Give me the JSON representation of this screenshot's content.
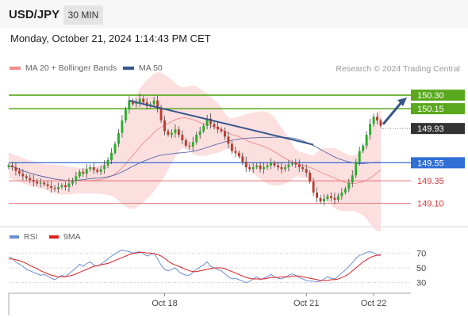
{
  "header": {
    "symbol": "USD/JPY",
    "timeframe": "30 MIN"
  },
  "datetime": "Monday, October 21, 2024 1:14:43 PM CET",
  "legend": {
    "ma20_label": "MA 20 + Bollinger Bands",
    "ma50_label": "MA 50",
    "rsi_label": "RSI",
    "rsi_ma_label": "9MA"
  },
  "credit": "Research © 2024 Trading Central",
  "colors": {
    "candle_up": "#27ae27",
    "candle_down": "#c0392b",
    "bollinger_fill": "#fcd9d9",
    "ma20": "#f08c8c",
    "ma50": "#5a6aa8",
    "trendline": "#34568b",
    "resistance": "#5aa81e",
    "pivot": "#2f6fd6",
    "support": "#e57373",
    "current_price": "#333333",
    "rsi": "#6b8fd6",
    "rsi_ma": "#e02020"
  },
  "chart_data": [
    {
      "type": "candlestick",
      "title": "USD/JPY",
      "timeframe": "30 MIN",
      "x_tick_labels": [
        "Oct 18",
        "Oct 21",
        "Oct 22"
      ],
      "ylim": [
        148.85,
        150.45
      ],
      "close_series": [
        149.52,
        149.5,
        149.46,
        149.43,
        149.4,
        149.38,
        149.36,
        149.34,
        149.32,
        149.33,
        149.31,
        149.29,
        149.27,
        149.26,
        149.28,
        149.3,
        149.28,
        149.32,
        149.35,
        149.4,
        149.45,
        149.43,
        149.48,
        149.5,
        149.47,
        149.45,
        149.48,
        149.52,
        149.58,
        149.66,
        149.76,
        149.88,
        150.02,
        150.14,
        150.24,
        150.2,
        150.22,
        150.26,
        150.22,
        150.18,
        150.2,
        150.24,
        150.16,
        150.02,
        149.9,
        149.86,
        149.88,
        149.92,
        149.86,
        149.8,
        149.74,
        149.73,
        149.78,
        149.86,
        149.9,
        149.96,
        150.04,
        149.98,
        149.95,
        149.92,
        149.9,
        149.84,
        149.76,
        149.68,
        149.66,
        149.62,
        149.56,
        149.5,
        149.48,
        149.5,
        149.52,
        149.48,
        149.5,
        149.52,
        149.55,
        149.52,
        149.5,
        149.48,
        149.5,
        149.53,
        149.55,
        149.53,
        149.5,
        149.48,
        149.44,
        149.34,
        149.22,
        149.16,
        149.12,
        149.15,
        149.18,
        149.16,
        149.14,
        149.18,
        149.22,
        149.26,
        149.33,
        149.41,
        149.56,
        149.68,
        149.74,
        149.86,
        149.98,
        150.06,
        150.02,
        149.96
      ],
      "series": [
        {
          "name": "MA 20 + Bollinger Bands"
        },
        {
          "name": "MA 50"
        }
      ],
      "levels": [
        {
          "label": "150.30",
          "value": 150.3,
          "kind": "resistance"
        },
        {
          "label": "150.15",
          "value": 150.15,
          "kind": "resistance"
        },
        {
          "label": "149.93",
          "value": 149.93,
          "kind": "current"
        },
        {
          "label": "149.55",
          "value": 149.55,
          "kind": "pivot"
        },
        {
          "label": "149.35",
          "value": 149.35,
          "kind": "support"
        },
        {
          "label": "149.10",
          "value": 149.1,
          "kind": "support"
        }
      ],
      "trendline": {
        "from_index": 34,
        "from_value": 150.24,
        "to_index": 86,
        "to_value": 149.75
      },
      "arrow": {
        "direction": "up",
        "target_value": 150.3
      }
    },
    {
      "type": "line",
      "title": "RSI",
      "series": [
        {
          "name": "RSI",
          "values": [
            65,
            63,
            58,
            55,
            52,
            48,
            46,
            44,
            42,
            40,
            41,
            39,
            36,
            34,
            37,
            40,
            38,
            42,
            46,
            50,
            55,
            52,
            56,
            58,
            54,
            52,
            55,
            58,
            62,
            66,
            69,
            72,
            74,
            73,
            72,
            70,
            71,
            72,
            69,
            66,
            68,
            70,
            62,
            54,
            48,
            46,
            48,
            50,
            45,
            42,
            40,
            40,
            44,
            48,
            51,
            54,
            58,
            52,
            50,
            48,
            46,
            42,
            38,
            35,
            36,
            34,
            32,
            30,
            32,
            35,
            38,
            34,
            36,
            38,
            41,
            38,
            36,
            35,
            37,
            40,
            42,
            40,
            37,
            35,
            33,
            32,
            32,
            31,
            32,
            35,
            38,
            36,
            35,
            39,
            43,
            47,
            52,
            57,
            63,
            67,
            68,
            71,
            72,
            70,
            68,
            66
          ]
        },
        {
          "name": "9MA",
          "values": [
            62,
            62,
            61,
            60,
            58,
            56,
            53,
            51,
            49,
            46,
            44,
            42,
            40,
            39,
            38,
            38,
            38,
            39,
            40,
            42,
            44,
            46,
            48,
            50,
            52,
            53,
            54,
            55,
            56,
            58,
            60,
            62,
            64,
            66,
            68,
            69,
            70,
            71,
            71,
            70,
            70,
            69,
            68,
            66,
            63,
            59,
            56,
            54,
            52,
            50,
            48,
            46,
            45,
            45,
            46,
            47,
            48,
            49,
            50,
            50,
            50,
            49,
            47,
            45,
            43,
            41,
            39,
            37,
            36,
            35,
            35,
            35,
            35,
            36,
            37,
            37,
            37,
            38,
            38,
            38,
            39,
            39,
            39,
            38,
            37,
            36,
            35,
            34,
            33,
            33,
            33,
            34,
            34,
            35,
            37,
            39,
            42,
            46,
            50,
            54,
            58,
            61,
            64,
            66,
            67,
            68
          ]
        }
      ],
      "ylim": [
        20,
        80
      ],
      "y_ticks": [
        30,
        50,
        70
      ],
      "y_tick_labels": [
        "30",
        "50",
        "70"
      ]
    }
  ]
}
